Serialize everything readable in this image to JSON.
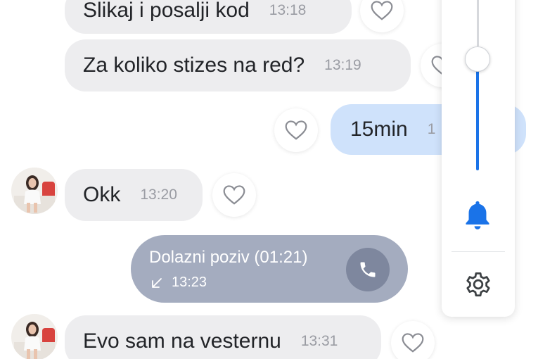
{
  "messages": [
    {
      "text": "Slikaj i posalji kod",
      "time": "13:18",
      "direction": "incoming"
    },
    {
      "text": "Za koliko stizes na red?",
      "time": "13:19",
      "direction": "incoming"
    },
    {
      "text": "15min",
      "time": "1",
      "direction": "outgoing"
    },
    {
      "text": "Okk",
      "time": "13:20",
      "direction": "incoming"
    },
    {
      "text": "Evo sam na vesternu",
      "time": "13:31",
      "direction": "incoming"
    }
  ],
  "call": {
    "title": "Dolazni poziv (01:21)",
    "time": "13:23"
  },
  "volume_panel": {
    "level_fraction": 0.72,
    "icons": [
      "bell-icon",
      "gear-icon"
    ]
  },
  "colors": {
    "incoming_bubble": "#ededef",
    "outgoing_bubble": "#cfe2fb",
    "call_bubble": "#a4acbf",
    "accent": "#1a73e8"
  }
}
